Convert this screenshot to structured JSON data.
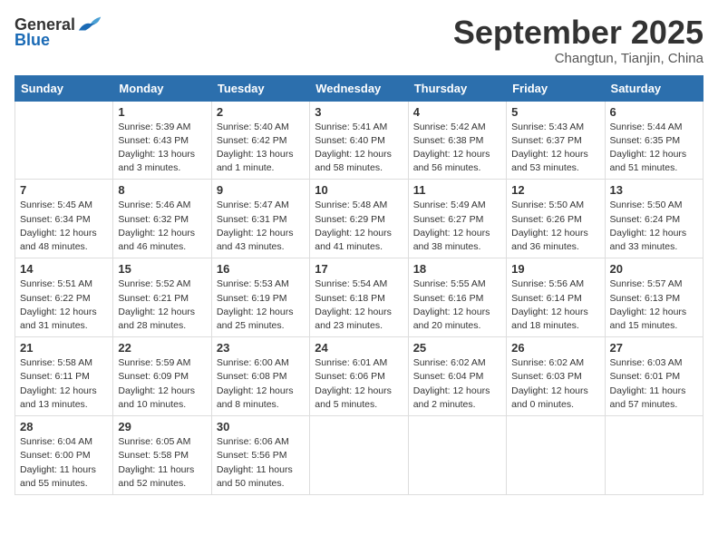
{
  "logo": {
    "general": "General",
    "blue": "Blue"
  },
  "title": "September 2025",
  "subtitle": "Changtun, Tianjin, China",
  "weekdays": [
    "Sunday",
    "Monday",
    "Tuesday",
    "Wednesday",
    "Thursday",
    "Friday",
    "Saturday"
  ],
  "weeks": [
    [
      {
        "day": "",
        "info": ""
      },
      {
        "day": "1",
        "info": "Sunrise: 5:39 AM\nSunset: 6:43 PM\nDaylight: 13 hours\nand 3 minutes."
      },
      {
        "day": "2",
        "info": "Sunrise: 5:40 AM\nSunset: 6:42 PM\nDaylight: 13 hours\nand 1 minute."
      },
      {
        "day": "3",
        "info": "Sunrise: 5:41 AM\nSunset: 6:40 PM\nDaylight: 12 hours\nand 58 minutes."
      },
      {
        "day": "4",
        "info": "Sunrise: 5:42 AM\nSunset: 6:38 PM\nDaylight: 12 hours\nand 56 minutes."
      },
      {
        "day": "5",
        "info": "Sunrise: 5:43 AM\nSunset: 6:37 PM\nDaylight: 12 hours\nand 53 minutes."
      },
      {
        "day": "6",
        "info": "Sunrise: 5:44 AM\nSunset: 6:35 PM\nDaylight: 12 hours\nand 51 minutes."
      }
    ],
    [
      {
        "day": "7",
        "info": "Sunrise: 5:45 AM\nSunset: 6:34 PM\nDaylight: 12 hours\nand 48 minutes."
      },
      {
        "day": "8",
        "info": "Sunrise: 5:46 AM\nSunset: 6:32 PM\nDaylight: 12 hours\nand 46 minutes."
      },
      {
        "day": "9",
        "info": "Sunrise: 5:47 AM\nSunset: 6:31 PM\nDaylight: 12 hours\nand 43 minutes."
      },
      {
        "day": "10",
        "info": "Sunrise: 5:48 AM\nSunset: 6:29 PM\nDaylight: 12 hours\nand 41 minutes."
      },
      {
        "day": "11",
        "info": "Sunrise: 5:49 AM\nSunset: 6:27 PM\nDaylight: 12 hours\nand 38 minutes."
      },
      {
        "day": "12",
        "info": "Sunrise: 5:50 AM\nSunset: 6:26 PM\nDaylight: 12 hours\nand 36 minutes."
      },
      {
        "day": "13",
        "info": "Sunrise: 5:50 AM\nSunset: 6:24 PM\nDaylight: 12 hours\nand 33 minutes."
      }
    ],
    [
      {
        "day": "14",
        "info": "Sunrise: 5:51 AM\nSunset: 6:22 PM\nDaylight: 12 hours\nand 31 minutes."
      },
      {
        "day": "15",
        "info": "Sunrise: 5:52 AM\nSunset: 6:21 PM\nDaylight: 12 hours\nand 28 minutes."
      },
      {
        "day": "16",
        "info": "Sunrise: 5:53 AM\nSunset: 6:19 PM\nDaylight: 12 hours\nand 25 minutes."
      },
      {
        "day": "17",
        "info": "Sunrise: 5:54 AM\nSunset: 6:18 PM\nDaylight: 12 hours\nand 23 minutes."
      },
      {
        "day": "18",
        "info": "Sunrise: 5:55 AM\nSunset: 6:16 PM\nDaylight: 12 hours\nand 20 minutes."
      },
      {
        "day": "19",
        "info": "Sunrise: 5:56 AM\nSunset: 6:14 PM\nDaylight: 12 hours\nand 18 minutes."
      },
      {
        "day": "20",
        "info": "Sunrise: 5:57 AM\nSunset: 6:13 PM\nDaylight: 12 hours\nand 15 minutes."
      }
    ],
    [
      {
        "day": "21",
        "info": "Sunrise: 5:58 AM\nSunset: 6:11 PM\nDaylight: 12 hours\nand 13 minutes."
      },
      {
        "day": "22",
        "info": "Sunrise: 5:59 AM\nSunset: 6:09 PM\nDaylight: 12 hours\nand 10 minutes."
      },
      {
        "day": "23",
        "info": "Sunrise: 6:00 AM\nSunset: 6:08 PM\nDaylight: 12 hours\nand 8 minutes."
      },
      {
        "day": "24",
        "info": "Sunrise: 6:01 AM\nSunset: 6:06 PM\nDaylight: 12 hours\nand 5 minutes."
      },
      {
        "day": "25",
        "info": "Sunrise: 6:02 AM\nSunset: 6:04 PM\nDaylight: 12 hours\nand 2 minutes."
      },
      {
        "day": "26",
        "info": "Sunrise: 6:02 AM\nSunset: 6:03 PM\nDaylight: 12 hours\nand 0 minutes."
      },
      {
        "day": "27",
        "info": "Sunrise: 6:03 AM\nSunset: 6:01 PM\nDaylight: 11 hours\nand 57 minutes."
      }
    ],
    [
      {
        "day": "28",
        "info": "Sunrise: 6:04 AM\nSunset: 6:00 PM\nDaylight: 11 hours\nand 55 minutes."
      },
      {
        "day": "29",
        "info": "Sunrise: 6:05 AM\nSunset: 5:58 PM\nDaylight: 11 hours\nand 52 minutes."
      },
      {
        "day": "30",
        "info": "Sunrise: 6:06 AM\nSunset: 5:56 PM\nDaylight: 11 hours\nand 50 minutes."
      },
      {
        "day": "",
        "info": ""
      },
      {
        "day": "",
        "info": ""
      },
      {
        "day": "",
        "info": ""
      },
      {
        "day": "",
        "info": ""
      }
    ]
  ]
}
